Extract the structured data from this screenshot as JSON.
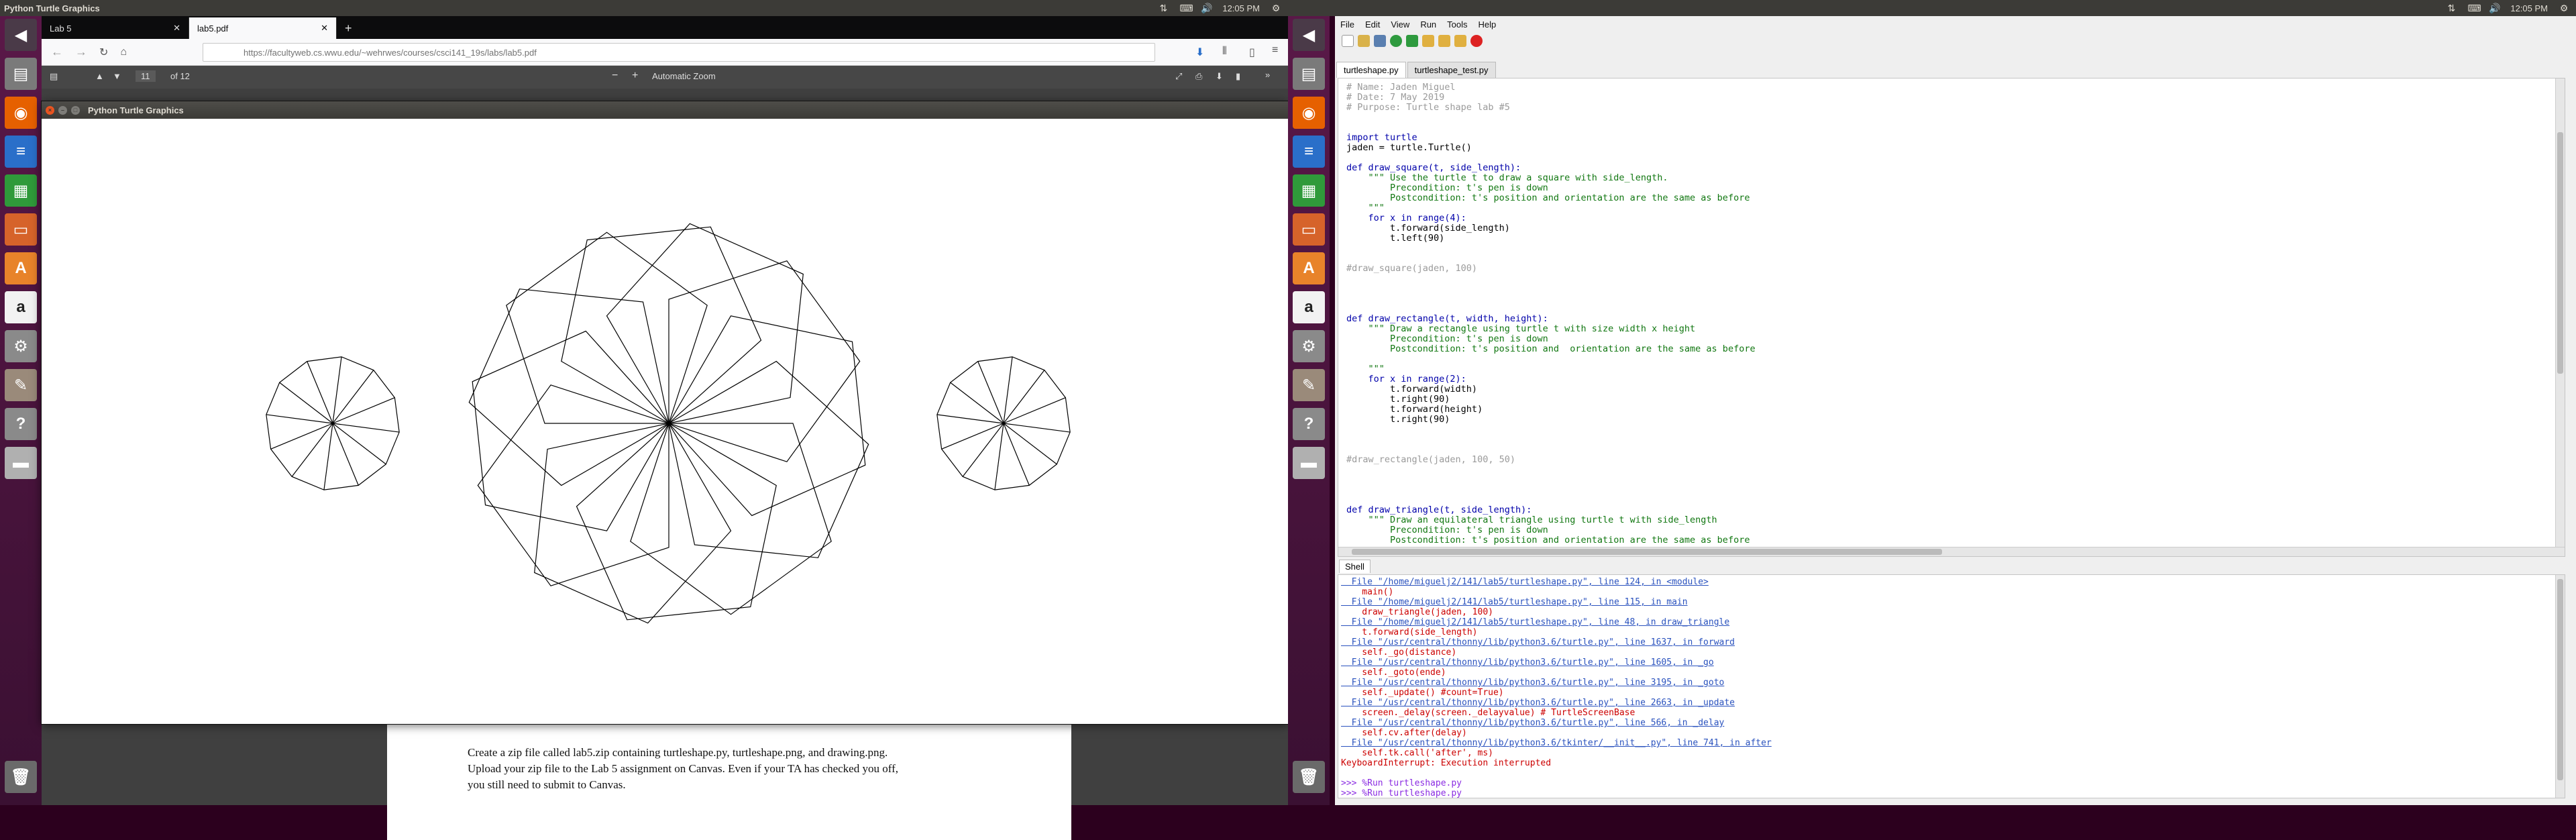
{
  "left_panel": {
    "title": "Python Turtle Graphics",
    "time": "12:05 PM"
  },
  "right_panel": {
    "time": "12:05 PM"
  },
  "firefox": {
    "tabs": [
      "Lab 5",
      "lab5.pdf"
    ],
    "new_tab": "+",
    "url": "https://facultyweb.cs.wwu.edu/~wehrwes/courses/csci141_19s/labs/lab5.pdf",
    "page_num": "11",
    "page_total": "of 12",
    "zoom": "Automatic Zoom",
    "pdf_text": [
      "Create a zip file called lab5.zip containing turtleshape.py, turtleshape.png, and drawing.png.",
      "Upload your zip file to the Lab 5 assignment on Canvas. Even if your TA has checked you off,",
      "you still need to submit to Canvas."
    ]
  },
  "turtle_window": {
    "title": "Python Turtle Graphics"
  },
  "thonny": {
    "menu": [
      "File",
      "Edit",
      "View",
      "Run",
      "Tools",
      "Help"
    ],
    "tabs": [
      "turtleshape.py",
      "turtleshape_test.py"
    ],
    "code": [
      {
        "t": "# Name: Jaden Miguel",
        "c": "cm"
      },
      {
        "t": "# Date: 7 May 2019",
        "c": "cm"
      },
      {
        "t": "# Purpose: Turtle shape lab #5",
        "c": "cm"
      },
      {
        "t": "",
        "c": ""
      },
      {
        "t": "",
        "c": ""
      },
      {
        "t": "import turtle",
        "c": "kw"
      },
      {
        "t": "jaden = turtle.Turtle()",
        "c": ""
      },
      {
        "t": "",
        "c": ""
      },
      {
        "t": "def draw_square(t, side_length):",
        "c": "kw"
      },
      {
        "t": "    \"\"\" Use the turtle t to draw a square with side_length.",
        "c": "st"
      },
      {
        "t": "        Precondition: t's pen is down",
        "c": "st"
      },
      {
        "t": "        Postcondition: t's position and orientation are the same as before",
        "c": "st"
      },
      {
        "t": "    \"\"\"",
        "c": "st"
      },
      {
        "t": "    for x in range(4):",
        "c": "kw"
      },
      {
        "t": "        t.forward(side_length)",
        "c": ""
      },
      {
        "t": "        t.left(90)",
        "c": ""
      },
      {
        "t": "",
        "c": ""
      },
      {
        "t": "",
        "c": ""
      },
      {
        "t": "#draw_square(jaden, 100)",
        "c": "cm"
      },
      {
        "t": "",
        "c": ""
      },
      {
        "t": "",
        "c": ""
      },
      {
        "t": "",
        "c": ""
      },
      {
        "t": "",
        "c": ""
      },
      {
        "t": "def draw_rectangle(t, width, height):",
        "c": "kw"
      },
      {
        "t": "    \"\"\" Draw a rectangle using turtle t with size width x height",
        "c": "st"
      },
      {
        "t": "        Precondition: t's pen is down",
        "c": "st"
      },
      {
        "t": "        Postcondition: t's position and  orientation are the same as before",
        "c": "st"
      },
      {
        "t": "",
        "c": ""
      },
      {
        "t": "    \"\"\"",
        "c": "st"
      },
      {
        "t": "    for x in range(2):",
        "c": "kw"
      },
      {
        "t": "        t.forward(width)",
        "c": ""
      },
      {
        "t": "        t.right(90)",
        "c": ""
      },
      {
        "t": "        t.forward(height)",
        "c": ""
      },
      {
        "t": "        t.right(90)",
        "c": ""
      },
      {
        "t": "",
        "c": ""
      },
      {
        "t": "",
        "c": ""
      },
      {
        "t": "",
        "c": ""
      },
      {
        "t": "#draw_rectangle(jaden, 100, 50)",
        "c": "cm"
      },
      {
        "t": "",
        "c": ""
      },
      {
        "t": "",
        "c": ""
      },
      {
        "t": "",
        "c": ""
      },
      {
        "t": "",
        "c": ""
      },
      {
        "t": "def draw_triangle(t, side_length):",
        "c": "kw"
      },
      {
        "t": "    \"\"\" Draw an equilateral triangle using turtle t with side_length",
        "c": "st"
      },
      {
        "t": "        Precondition: t's pen is down",
        "c": "st"
      },
      {
        "t": "        Postcondition: t's position and orientation are the same as before",
        "c": "st"
      }
    ],
    "shell_label": "Shell",
    "shell": [
      {
        "t": "  File \"/home/miguelj2/141/lab5/turtleshape.py\", line 124, in <module>",
        "c": "ln"
      },
      {
        "t": "    main()",
        "c": "er"
      },
      {
        "t": "  File \"/home/miguelj2/141/lab5/turtleshape.py\", line 115, in main",
        "c": "ln"
      },
      {
        "t": "    draw_triangle(jaden, 100)",
        "c": "er"
      },
      {
        "t": "  File \"/home/miguelj2/141/lab5/turtleshape.py\", line 48, in draw_triangle",
        "c": "ln"
      },
      {
        "t": "    t.forward(side_length)",
        "c": "er"
      },
      {
        "t": "  File \"/usr/central/thonny/lib/python3.6/turtle.py\", line 1637, in forward",
        "c": "ln"
      },
      {
        "t": "    self._go(distance)",
        "c": "er"
      },
      {
        "t": "  File \"/usr/central/thonny/lib/python3.6/turtle.py\", line 1605, in _go",
        "c": "ln"
      },
      {
        "t": "    self._goto(ende)",
        "c": "er"
      },
      {
        "t": "  File \"/usr/central/thonny/lib/python3.6/turtle.py\", line 3195, in _goto",
        "c": "ln"
      },
      {
        "t": "    self._update() #count=True)",
        "c": "er"
      },
      {
        "t": "  File \"/usr/central/thonny/lib/python3.6/turtle.py\", line 2663, in _update",
        "c": "ln"
      },
      {
        "t": "    screen._delay(screen._delayvalue) # TurtleScreenBase",
        "c": "er"
      },
      {
        "t": "  File \"/usr/central/thonny/lib/python3.6/turtle.py\", line 566, in _delay",
        "c": "ln"
      },
      {
        "t": "    self.cv.after(delay)",
        "c": "er"
      },
      {
        "t": "  File \"/usr/central/thonny/lib/python3.6/tkinter/__init__.py\", line 741, in after",
        "c": "ln"
      },
      {
        "t": "    self.tk.call('after', ms)",
        "c": "er"
      },
      {
        "t": "KeyboardInterrupt: Execution interrupted",
        "c": "er"
      },
      {
        "t": "",
        "c": ""
      },
      {
        "t": ">>> %Run turtleshape.py",
        "c": "pr"
      },
      {
        "t": ">>> %Run turtleshape.py",
        "c": "pr"
      },
      {
        "t": ">>> ",
        "c": "pr"
      }
    ]
  },
  "colors": {
    "comment": "#9a9a9a",
    "keyword": "#0000aa",
    "string": "#117711",
    "error": "#cc0000",
    "link": "#2a52be",
    "prompt": "#8a2be2"
  },
  "icons": [
    "dash-icon",
    "files-icon",
    "firefox-icon",
    "writer-icon",
    "calc-icon",
    "impress-icon",
    "software-icon",
    "amazon-icon",
    "settings-icon",
    "tools-icon",
    "help-icon",
    "drive-icon",
    "trash-icon"
  ]
}
